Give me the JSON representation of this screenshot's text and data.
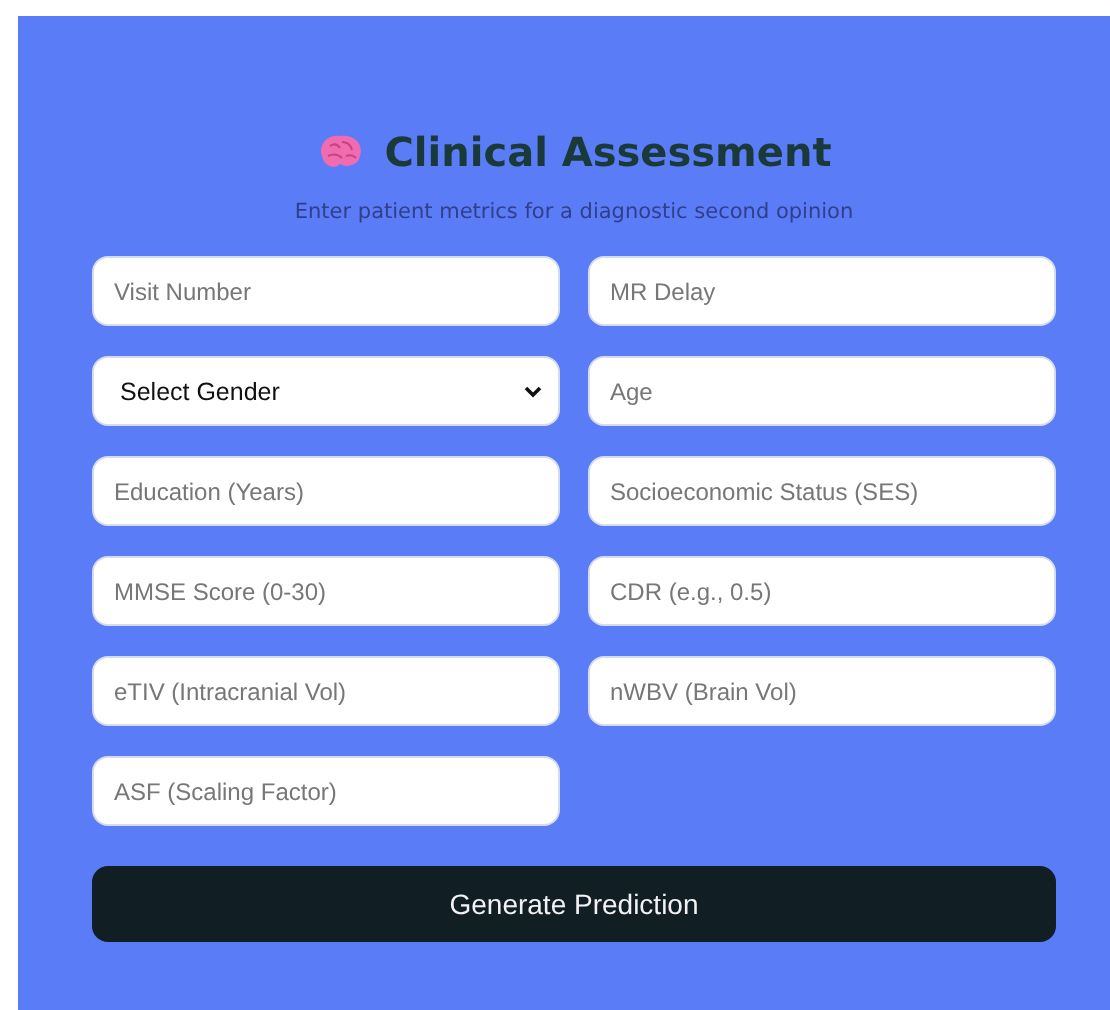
{
  "title": "Clinical Assessment",
  "subtitle": "Enter patient metrics for a diagnostic second opinion",
  "fields": [
    {
      "kind": "input",
      "placeholder": "Visit Number"
    },
    {
      "kind": "input",
      "placeholder": "MR Delay"
    },
    {
      "kind": "select",
      "value": "Select Gender"
    },
    {
      "kind": "input",
      "placeholder": "Age"
    },
    {
      "kind": "input",
      "placeholder": "Education (Years)"
    },
    {
      "kind": "input",
      "placeholder": "Socioeconomic Status (SES)"
    },
    {
      "kind": "input",
      "placeholder": "MMSE Score (0-30)"
    },
    {
      "kind": "input",
      "placeholder": "CDR (e.g., 0.5)"
    },
    {
      "kind": "input",
      "placeholder": "eTIV (Intracranial Vol)"
    },
    {
      "kind": "input",
      "placeholder": "nWBV (Brain Vol)"
    },
    {
      "kind": "input",
      "placeholder": "ASF (Scaling Factor)"
    }
  ],
  "button": "Generate Prediction"
}
